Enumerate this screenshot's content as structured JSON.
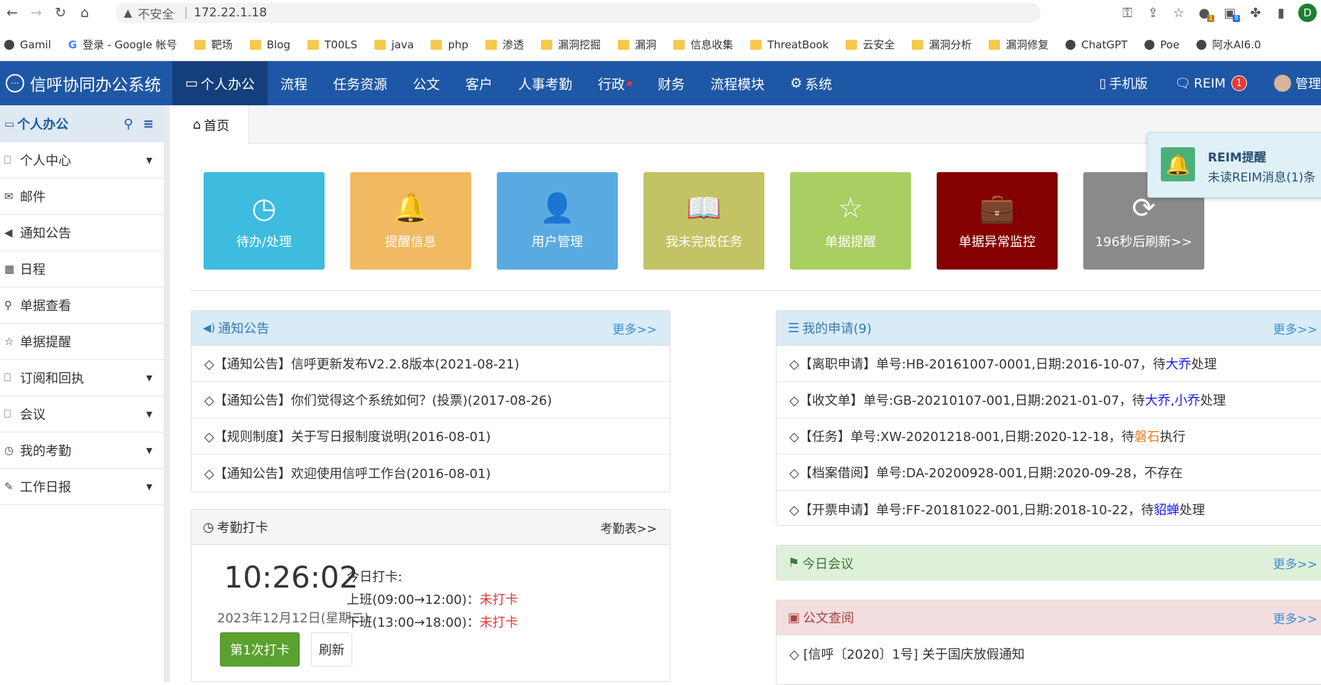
{
  "browser": {
    "insecure_label": "不安全",
    "url": "172.22.1.18",
    "profile_letter": "D",
    "ext_badge_1": "1",
    "ext_badge_2": "8"
  },
  "bookmarks": [
    "Gamil",
    "登录 - Google 帐号",
    "靶场",
    "Blog",
    "T00LS",
    "java",
    "php",
    "渗透",
    "漏洞挖掘",
    "漏洞",
    "信息收集",
    "ThreatBook",
    "云安全",
    "漏洞分析",
    "漏洞修复",
    "ChatGPT",
    "Poe",
    "阿水AI6.0"
  ],
  "app": {
    "brand": "信呼协同办公系统",
    "nav": [
      "个人办公",
      "流程",
      "任务资源",
      "公文",
      "客户",
      "人事考勤",
      "行政",
      "财务",
      "流程模块",
      "系统"
    ],
    "mobile_label": "手机版",
    "reim_label": "REIM",
    "reim_count": "1",
    "admin_label": "管理"
  },
  "sidebar": {
    "title": "个人办公",
    "items": [
      "个人中心",
      "邮件",
      "通知公告",
      "日程",
      "单据查看",
      "单据提醒",
      "订阅和回执",
      "会议",
      "我的考勤",
      "工作日报"
    ]
  },
  "tab": {
    "home": "首页"
  },
  "tiles": [
    {
      "label": "待办/处理",
      "color": "#3dbce0",
      "icon": "clock-icon"
    },
    {
      "label": "提醒信息",
      "color": "#f0b962",
      "icon": "bell-icon"
    },
    {
      "label": "用户管理",
      "color": "#5aaae2",
      "icon": "user-icon"
    },
    {
      "label": "我未完成任务",
      "color": "#c2c364",
      "icon": "book-icon"
    },
    {
      "label": "单据提醒",
      "color": "#a9ce62",
      "icon": "star-icon"
    },
    {
      "label": "单据异常监控",
      "color": "#850000",
      "icon": "briefcase-icon"
    },
    {
      "label": "196秒后刷新>>",
      "color": "#8a8a8a",
      "icon": "refresh-icon"
    }
  ],
  "notice_panel": {
    "title": "通知公告",
    "more": "更多>>",
    "items": [
      "◇【通知公告】信呼更新发布V2.2.8版本(2021-08-21)",
      "◇【通知公告】你们觉得这个系统如何？(投票)(2017-08-26)",
      "◇【规则制度】关于写日报制度说明(2016-08-01)",
      "◇【通知公告】欢迎使用信呼工作台(2016-08-01)"
    ]
  },
  "apply_panel": {
    "title": "我的申请(9)",
    "more": "更多>>",
    "items": [
      {
        "pre": "◇【离职申请】单号:HB-20161007-0001,日期:2016-10-07，待",
        "name": "大乔",
        "post": "处理",
        "tone": "blue"
      },
      {
        "pre": "◇【收文单】单号:GB-20210107-001,日期:2021-01-07，待",
        "name": "大乔,小乔",
        "post": "处理",
        "tone": "blue"
      },
      {
        "pre": "◇【任务】单号:XW-20201218-001,日期:2020-12-18，待",
        "name": "磐石",
        "post": "执行",
        "tone": "orange"
      },
      {
        "pre": "◇【档案借阅】单号:DA-20200928-001,日期:2020-09-28，不存在",
        "name": "",
        "post": "",
        "tone": "blue"
      },
      {
        "pre": "◇【开票申请】单号:FF-20181022-001,日期:2018-10-22，待",
        "name": "貂蝉",
        "post": "处理",
        "tone": "blue"
      }
    ]
  },
  "attendance": {
    "title": "考勤打卡",
    "more": "考勤表>>",
    "time": "10:26:02",
    "date": "2023年12月12日(星期二)",
    "punch_btn": "第1次打卡",
    "refresh_btn": "刷新",
    "today_label": "今日打卡:",
    "morning": "上班(09:00→12:00)：",
    "afternoon": "下班(13:00→18:00)：",
    "status_morning": "未打卡",
    "status_afternoon": "未打卡"
  },
  "meeting_panel": {
    "title": "今日会议",
    "more": "更多>>"
  },
  "doc_panel": {
    "title": "公文查阅",
    "more": "更多>>",
    "items": [
      "◇ [信呼〔2020〕1号] 关于国庆放假通知"
    ]
  },
  "toast": {
    "title": "REIM提醒",
    "message": "未读REIM消息(1)条",
    "close": "×"
  }
}
